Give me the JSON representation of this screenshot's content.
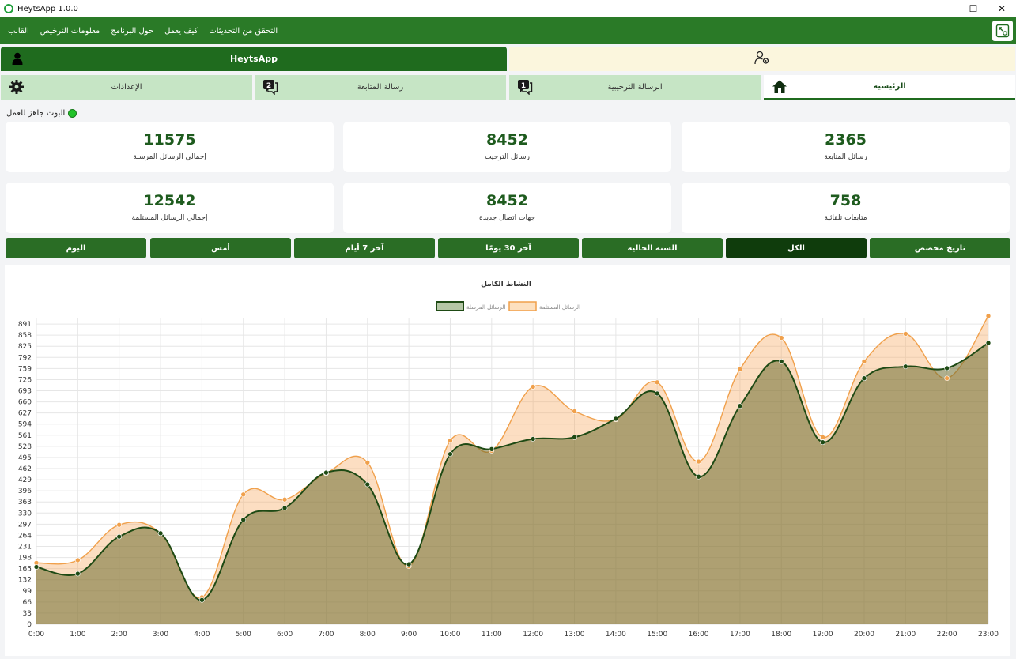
{
  "window": {
    "title": "HeytsApp 1.0.0",
    "minimize": "—",
    "maximize": "☐",
    "close": "✕"
  },
  "menu": [
    "القالب",
    "معلومات الترخيص",
    "حول البرنامج",
    "كيف يعمل",
    "التحقق من التحديثات"
  ],
  "icons": {
    "menu_right": "window-icon",
    "account": "user-icon",
    "add_user": "user-gear-icon",
    "home": "home-icon",
    "welcome": "chat-1-icon",
    "followup": "chat-2-icon",
    "settings": "gear-icon"
  },
  "colors": {
    "primary": "#2a6d25",
    "dark": "#0f3c0c",
    "sent": "#1e4a14",
    "received": "#f0a04b",
    "status": "#22c32a"
  },
  "top_tabs": {
    "app_tab": "HeytsApp"
  },
  "nav_tabs": {
    "home": "الرئيسية",
    "welcome": "الرسالة الترحيبية",
    "followup": "رسالة المتابعة",
    "settings": "الإعدادات"
  },
  "status": "البوت جاهز للعمل",
  "stats": {
    "followup_msgs": {
      "value": "2365",
      "label": "رسائل المتابعة"
    },
    "welcome_msgs": {
      "value": "8452",
      "label": "رسائل الترحيب"
    },
    "total_sent": {
      "value": "11575",
      "label": "إجمالي الرسائل المرسلة"
    },
    "auto_followers": {
      "value": "758",
      "label": "متابعات تلقائية"
    },
    "new_contacts": {
      "value": "8452",
      "label": "جهات اتصال جديدة"
    },
    "total_received": {
      "value": "12542",
      "label": "إجمالي الرسائل المستلمة"
    }
  },
  "filters": {
    "custom": "تاريخ مخصص",
    "all": "الكل",
    "this_year": "السنة الحالية",
    "last30": "آخر 30 يومًا",
    "last7": "آخر 7 أيام",
    "yesterday": "أمس",
    "today": "اليوم",
    "selected": "الكل"
  },
  "chart_data": {
    "type": "area",
    "title": "النشاط الكامل",
    "x": [
      "0:00",
      "1:00",
      "2:00",
      "3:00",
      "4:00",
      "5:00",
      "6:00",
      "7:00",
      "8:00",
      "9:00",
      "10:00",
      "11:00",
      "12:00",
      "13:00",
      "14:00",
      "15:00",
      "16:00",
      "17:00",
      "18:00",
      "19:00",
      "20:00",
      "21:00",
      "22:00",
      "23:00"
    ],
    "series": [
      {
        "name": "الرسائل المرسلة",
        "color": "#1e4a14",
        "values": [
          170,
          150,
          260,
          270,
          72,
          310,
          345,
          450,
          415,
          178,
          505,
          520,
          550,
          555,
          610,
          685,
          438,
          648,
          780,
          540,
          730,
          765,
          760,
          835
        ]
      },
      {
        "name": "الرسائل المستلمة",
        "color": "#f0a04b",
        "values": [
          182,
          190,
          295,
          270,
          80,
          385,
          370,
          448,
          480,
          172,
          545,
          515,
          705,
          632,
          608,
          718,
          483,
          757,
          850,
          555,
          780,
          862,
          730,
          915
        ]
      }
    ],
    "yticks": [
      0,
      33,
      66,
      99,
      132,
      165,
      198,
      231,
      264,
      297,
      330,
      363,
      396,
      429,
      462,
      495,
      528,
      561,
      594,
      627,
      660,
      693,
      726,
      759,
      792,
      825,
      858,
      891
    ],
    "ylim": [
      0,
      910
    ],
    "grid": true,
    "legend": "top-center"
  }
}
